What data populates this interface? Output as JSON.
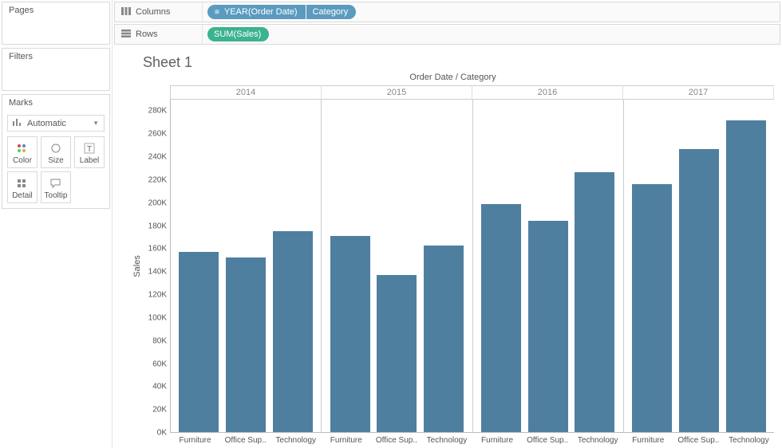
{
  "sidebar": {
    "pages_title": "Pages",
    "filters_title": "Filters",
    "marks_title": "Marks",
    "marks_select": {
      "icon": "bar-chart-icon",
      "label": "Automatic"
    },
    "mark_buttons": [
      {
        "name": "color-btn",
        "label": "Color",
        "icon": "color-dots"
      },
      {
        "name": "size-btn",
        "label": "Size",
        "icon": "size-circle"
      },
      {
        "name": "label-btn",
        "label": "Label",
        "icon": "text-t"
      },
      {
        "name": "detail-btn",
        "label": "Detail",
        "icon": "detail-grid"
      },
      {
        "name": "tooltip-btn",
        "label": "Tooltip",
        "icon": "speech"
      }
    ]
  },
  "shelves": {
    "columns_label": "Columns",
    "rows_label": "Rows",
    "columns_pills": [
      {
        "name": "year-orderdate-pill",
        "text": "YEAR(Order Date)",
        "cls": "blue",
        "expand": true
      },
      {
        "name": "category-pill",
        "text": "Category",
        "cls": "blue",
        "expand": false
      }
    ],
    "rows_pills": [
      {
        "name": "sum-sales-pill",
        "text": "SUM(Sales)",
        "cls": "green",
        "expand": false
      }
    ]
  },
  "sheet": {
    "title": "Sheet 1",
    "header": "Order Date / Category",
    "y_label": "Sales"
  },
  "chart_data": {
    "type": "bar",
    "title": "Sheet 1",
    "xlabel": "Order Date / Category",
    "ylabel": "Sales",
    "ylim": [
      0,
      290000
    ],
    "y_ticks": [
      0,
      20000,
      40000,
      60000,
      80000,
      100000,
      120000,
      140000,
      160000,
      180000,
      200000,
      220000,
      240000,
      260000,
      280000
    ],
    "y_tick_labels": [
      "0K",
      "20K",
      "40K",
      "60K",
      "80K",
      "100K",
      "120K",
      "140K",
      "160K",
      "180K",
      "200K",
      "220K",
      "240K",
      "260K",
      "280K"
    ],
    "years": [
      "2014",
      "2015",
      "2016",
      "2017"
    ],
    "categories": [
      "Furniture",
      "Office Sup..",
      "Technology"
    ],
    "series": [
      {
        "year": "2014",
        "values": [
          157000,
          152000,
          175000
        ]
      },
      {
        "year": "2015",
        "values": [
          171000,
          137000,
          163000
        ]
      },
      {
        "year": "2016",
        "values": [
          199000,
          184000,
          227000
        ]
      },
      {
        "year": "2017",
        "values": [
          216000,
          247000,
          272000
        ]
      }
    ]
  }
}
